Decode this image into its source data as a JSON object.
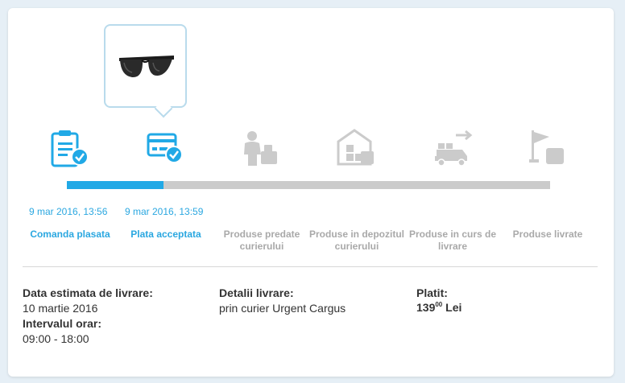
{
  "colors": {
    "accent": "#21a9e6",
    "inactive": "#cbcbcb",
    "inactive_text": "#a9a9a9"
  },
  "product": {
    "icon": "sunglasses-icon"
  },
  "progress": {
    "completed_steps": 2,
    "total_steps": 6
  },
  "steps": [
    {
      "icon": "clipboard-check-icon",
      "date": "9 mar 2016, 13:56",
      "label": "Comanda plasata",
      "status": "done"
    },
    {
      "icon": "credit-card-check-icon",
      "date": "9 mar 2016, 13:59",
      "label": "Plata acceptata",
      "status": "done"
    },
    {
      "icon": "courier-handover-icon",
      "date": "",
      "label": "Produse predate curierului",
      "status": "pending"
    },
    {
      "icon": "warehouse-icon",
      "date": "",
      "label": "Produse in depozitul curierului",
      "status": "pending"
    },
    {
      "icon": "delivery-truck-icon",
      "date": "",
      "label": "Produse in curs de livrare",
      "status": "pending"
    },
    {
      "icon": "flag-package-icon",
      "date": "",
      "label": "Produse livrate",
      "status": "pending"
    }
  ],
  "details": {
    "estimated_title": "Data estimata de livrare:",
    "estimated_value": "10 martie 2016",
    "interval_title": "Intervalul orar:",
    "interval_value": "09:00 - 18:00",
    "delivery_title": "Detalii livrare:",
    "delivery_value": "prin curier Urgent Cargus",
    "paid_title": "Platit:",
    "paid_amount": "139",
    "paid_decimals": "00",
    "paid_currency": "Lei"
  }
}
